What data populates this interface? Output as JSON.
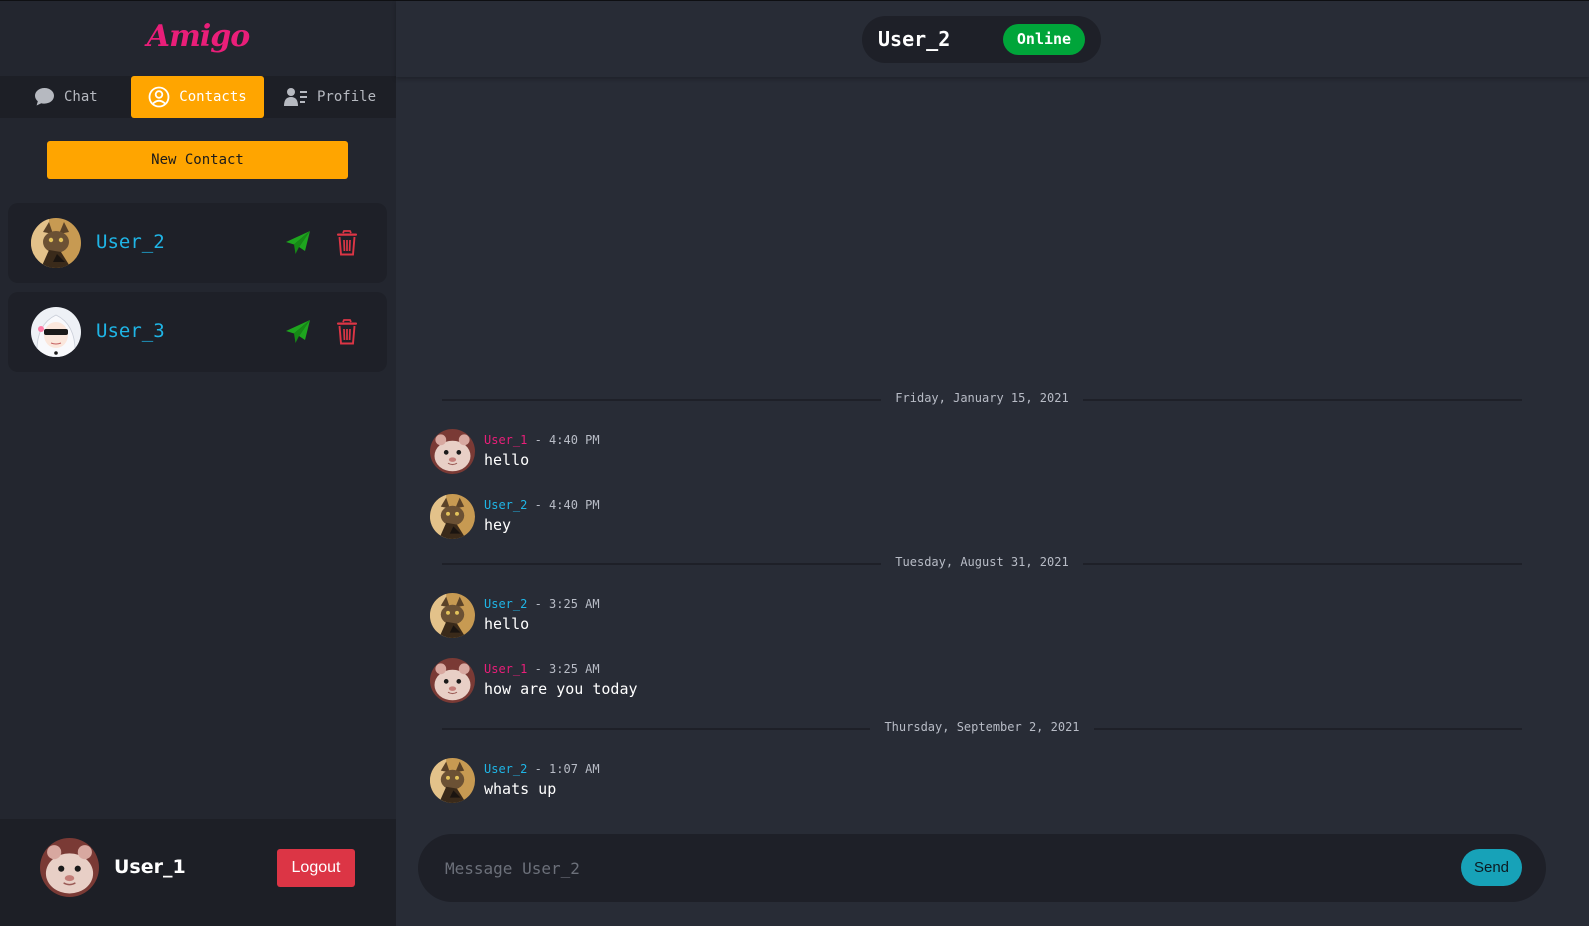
{
  "app": {
    "title": "Amigo",
    "brand_color": "#e91e79"
  },
  "tabs": [
    {
      "label": "Chat",
      "icon": "chat-bubble-icon",
      "active": false
    },
    {
      "label": "Contacts",
      "icon": "user-circle-icon",
      "active": true
    },
    {
      "label": "Profile",
      "icon": "user-list-icon",
      "active": false
    }
  ],
  "new_contact_label": "New Contact",
  "contacts": [
    {
      "name": "User_2",
      "avatar": "cat-avatar"
    },
    {
      "name": "User_3",
      "avatar": "anime-sunglasses-avatar"
    }
  ],
  "current_user": {
    "name": "User_1",
    "avatar": "hamster-avatar",
    "logout_label": "Logout"
  },
  "conversation": {
    "name": "User_2",
    "status": "Online",
    "status_color": "#00a53a",
    "days": [
      {
        "date": "Friday, January 15, 2021",
        "messages": [
          {
            "user": "User_1",
            "time": "4:40 PM",
            "text": "hello"
          },
          {
            "user": "User_2",
            "time": "4:40 PM",
            "text": "hey"
          }
        ]
      },
      {
        "date": "Tuesday, August 31, 2021",
        "messages": [
          {
            "user": "User_2",
            "time": "3:25 AM",
            "text": "hello"
          },
          {
            "user": "User_1",
            "time": "3:25 AM",
            "text": "how are you today"
          }
        ]
      },
      {
        "date": "Thursday, September 2, 2021",
        "messages": [
          {
            "user": "User_2",
            "time": "1:07 AM",
            "text": "whats up"
          }
        ]
      }
    ]
  },
  "composer": {
    "placeholder": "Message User_2",
    "send_label": "Send"
  },
  "colors": {
    "accent": "#ffa500",
    "username_self": "#e91e79",
    "username_other": "#1fb5e6",
    "danger": "#dc3545",
    "send": "#17a2b8"
  }
}
